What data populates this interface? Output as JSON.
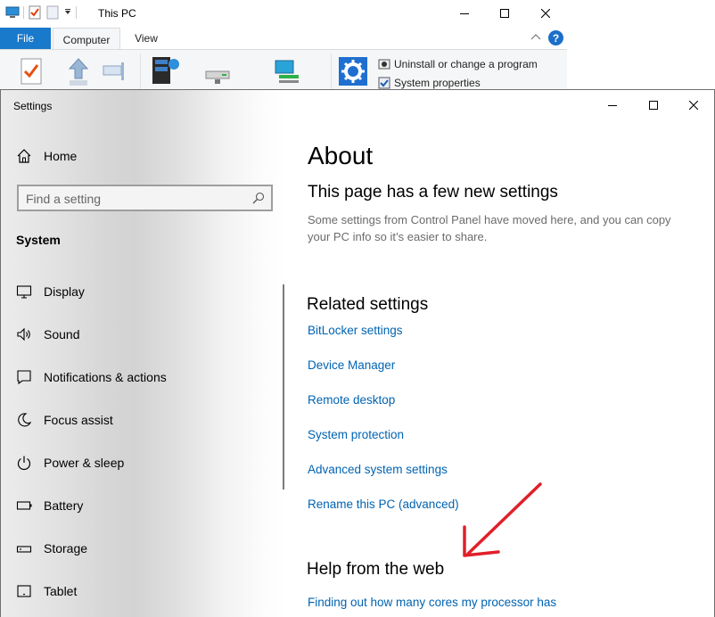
{
  "explorer": {
    "title": "This PC",
    "tabs": [
      {
        "label": "File"
      },
      {
        "label": "Computer"
      },
      {
        "label": "View"
      }
    ],
    "ribbon_small": [
      {
        "label": "Uninstall or change a program"
      },
      {
        "label": "System properties"
      }
    ],
    "help_glyph": "?"
  },
  "settings": {
    "window_title": "Settings",
    "home_label": "Home",
    "search": {
      "placeholder": "Find a setting"
    },
    "section_label": "System",
    "nav": [
      {
        "label": "Display",
        "icon": "display-icon"
      },
      {
        "label": "Sound",
        "icon": "sound-icon"
      },
      {
        "label": "Notifications & actions",
        "icon": "notifications-icon"
      },
      {
        "label": "Focus assist",
        "icon": "focus-assist-icon"
      },
      {
        "label": "Power & sleep",
        "icon": "power-icon"
      },
      {
        "label": "Battery",
        "icon": "battery-icon"
      },
      {
        "label": "Storage",
        "icon": "storage-icon"
      },
      {
        "label": "Tablet",
        "icon": "tablet-icon"
      }
    ],
    "content": {
      "title": "About",
      "new_settings_heading": "This page has a few new settings",
      "new_settings_desc": "Some settings from Control Panel have moved here, and you can copy your PC info so it’s easier to share.",
      "related_heading": "Related settings",
      "related_links": [
        {
          "label": "BitLocker settings"
        },
        {
          "label": "Device Manager"
        },
        {
          "label": "Remote desktop"
        },
        {
          "label": "System protection"
        },
        {
          "label": "Advanced system settings"
        },
        {
          "label": "Rename this PC (advanced)"
        }
      ],
      "help_heading": "Help from the web",
      "help_links": [
        {
          "label": "Finding out how many cores my processor has"
        }
      ]
    }
  },
  "colors": {
    "link": "#0063b1",
    "file_tab": "#1979ca",
    "annotation_arrow": "#e0202a"
  }
}
